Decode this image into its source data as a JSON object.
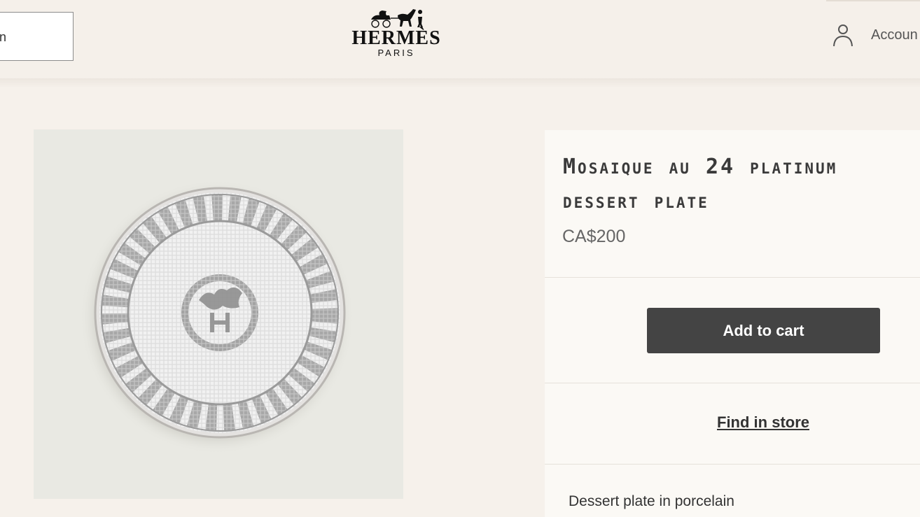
{
  "header": {
    "search_text": "n",
    "logo": {
      "wordmark": "HERMÈS",
      "subtitle": "PARIS"
    },
    "account_label": "Accoun"
  },
  "product": {
    "title": "Mosaique au 24 platinum dessert plate",
    "price": "CA$200",
    "add_to_cart_label": "Add to cart",
    "find_in_store_label": "Find in store",
    "description": "Dessert plate in porcelain",
    "image_alt": "Mosaique au 24 platinum dessert plate"
  },
  "colors": {
    "page_background": "#f6f1eb",
    "panel_background": "#fbf9f5",
    "button_background": "#444444",
    "button_text": "#ffffff",
    "plate_pattern": "#8f8f8f"
  },
  "icons": {
    "logo": "carriage-logo-icon",
    "account": "user-icon"
  }
}
